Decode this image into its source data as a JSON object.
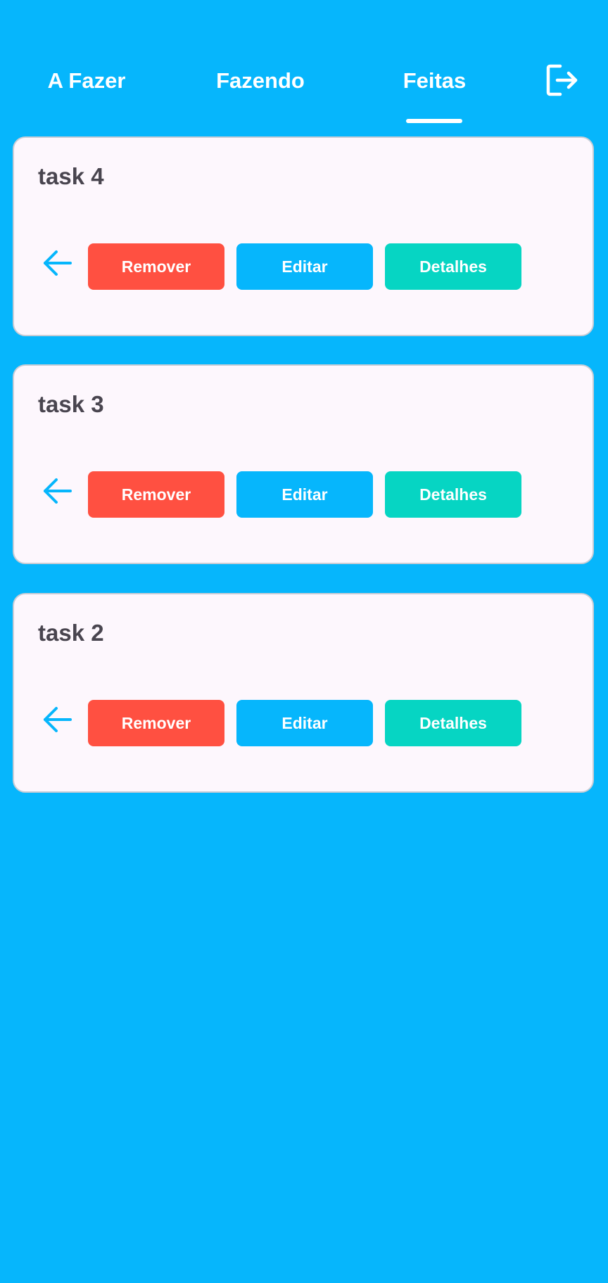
{
  "tabs": [
    {
      "label": "A Fazer"
    },
    {
      "label": "Fazendo"
    },
    {
      "label": "Feitas",
      "selected": true
    }
  ],
  "header": {
    "logout_icon": "logout-icon"
  },
  "tasks": [
    {
      "title": "task 4",
      "back_icon": "arrow-left-icon",
      "remove_label": "Remover",
      "edit_label": "Editar",
      "details_label": "Detalhes"
    },
    {
      "title": "task 3",
      "back_icon": "arrow-left-icon",
      "remove_label": "Remover",
      "edit_label": "Editar",
      "details_label": "Detalhes"
    },
    {
      "title": "task 2",
      "back_icon": "arrow-left-icon",
      "remove_label": "Remover",
      "edit_label": "Editar",
      "details_label": "Detalhes"
    }
  ],
  "colors": {
    "background": "#06b6fc",
    "card": "#fdf7fd",
    "remove": "#ff5041",
    "edit": "#06b6fc",
    "details": "#06d5c3",
    "title_text": "#49454f"
  }
}
